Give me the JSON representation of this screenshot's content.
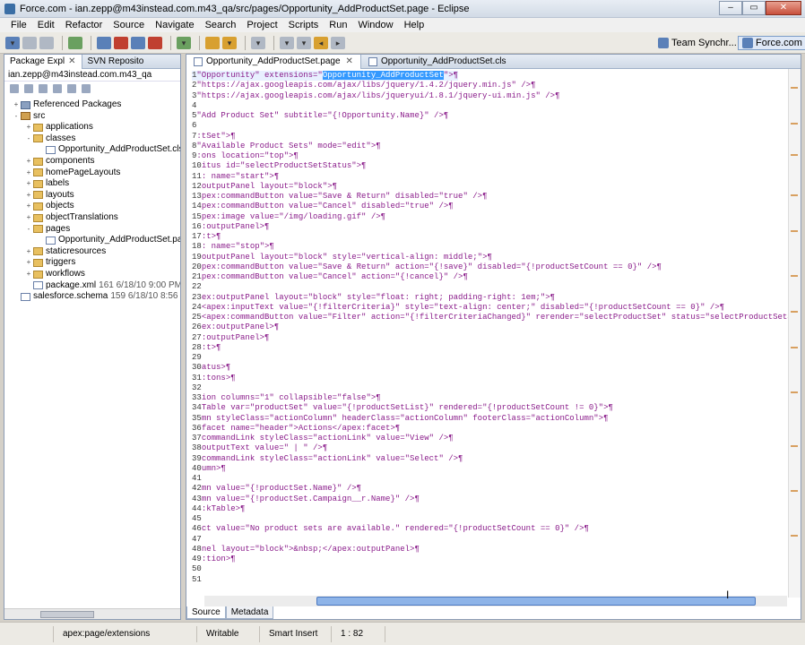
{
  "window": {
    "title": "Force.com - ian.zepp@m43instead.com.m43_qa/src/pages/Opportunity_AddProductSet.page - Eclipse"
  },
  "menu": [
    "File",
    "Edit",
    "Refactor",
    "Source",
    "Navigate",
    "Search",
    "Project",
    "Scripts",
    "Run",
    "Window",
    "Help"
  ],
  "perspectives": {
    "team": "Team Synchr...",
    "force": "Force.com"
  },
  "left": {
    "tabs": [
      {
        "label": "Package Expl"
      },
      {
        "label": "SVN Reposito"
      }
    ],
    "project": "ian.zepp@m43instead.com.m43_qa",
    "tree": [
      {
        "label": "Referenced Packages",
        "icon": "pkg",
        "indent": 0,
        "expander": "+"
      },
      {
        "label": "src",
        "icon": "src",
        "indent": 0,
        "expander": "-"
      },
      {
        "label": "applications",
        "icon": "folder",
        "indent": 1,
        "expander": "+"
      },
      {
        "label": "classes",
        "icon": "folder",
        "indent": 1,
        "expander": "-"
      },
      {
        "label": "Opportunity_AddProductSet.cls",
        "icon": "file",
        "indent": 2,
        "expander": ""
      },
      {
        "label": "components",
        "icon": "folder",
        "indent": 1,
        "expander": "+"
      },
      {
        "label": "homePageLayouts",
        "icon": "folder",
        "indent": 1,
        "expander": "+"
      },
      {
        "label": "labels",
        "icon": "folder",
        "indent": 1,
        "expander": "+"
      },
      {
        "label": "layouts",
        "icon": "folder",
        "indent": 1,
        "expander": "+"
      },
      {
        "label": "objects",
        "icon": "folder",
        "indent": 1,
        "expander": "+"
      },
      {
        "label": "objectTranslations",
        "icon": "folder",
        "indent": 1,
        "expander": "+"
      },
      {
        "label": "pages",
        "icon": "folder",
        "indent": 1,
        "expander": "-"
      },
      {
        "label": "Opportunity_AddProductSet.page",
        "icon": "file",
        "indent": 2,
        "expander": ""
      },
      {
        "label": "staticresources",
        "icon": "folder",
        "indent": 1,
        "expander": "+"
      },
      {
        "label": "triggers",
        "icon": "folder",
        "indent": 1,
        "expander": "+"
      },
      {
        "label": "workflows",
        "icon": "folder",
        "indent": 1,
        "expander": "+"
      },
      {
        "label": "package.xml",
        "icon": "file",
        "indent": 1,
        "expander": "",
        "meta": "161  6/18/10 9:00 PM  m43i"
      },
      {
        "label": "salesforce.schema",
        "icon": "file",
        "indent": 0,
        "expander": "",
        "meta": "159  6/18/10 8:56 PM  m43"
      }
    ]
  },
  "editor": {
    "tabs": [
      {
        "label": "Opportunity_AddProductSet.page"
      },
      {
        "label": "Opportunity_AddProductSet.cls"
      }
    ],
    "bottom_tabs": [
      "Source",
      "Metadata"
    ],
    "lines": [
      {
        "n": "1",
        "pre": "\"Opportunity\" extensions=\"",
        "sel": "Opportunity_AddProductSet",
        "post": "\">¶"
      },
      {
        "n": "2",
        "pre": "\"https://ajax.googleapis.com/ajax/libs/jquery/1.4.2/jquery.min.js\" />¶"
      },
      {
        "n": "3",
        "pre": "\"https://ajax.googleapis.com/ajax/libs/jqueryui/1.8.1/jquery-ui.min.js\" />¶"
      },
      {
        "n": "4",
        "pre": ""
      },
      {
        "n": "5",
        "pre": "\"Add Product Set\" subtitle=\"{!Opportunity.Name}\" />¶"
      },
      {
        "n": "6",
        "pre": ""
      },
      {
        "n": "7",
        "pre": ":tSet\">¶"
      },
      {
        "n": "8",
        "pre": "\"Available Product Sets\" mode=\"edit\">¶"
      },
      {
        "n": "9",
        "pre": ":ons location=\"top\">¶"
      },
      {
        "n": "10",
        "pre": "itus id=\"selectProductSetStatus\">¶"
      },
      {
        "n": "11",
        "pre": ": name=\"start\">¶"
      },
      {
        "n": "12",
        "pre": "outputPanel layout=\"block\">¶"
      },
      {
        "n": "13",
        "pre": "pex:commandButton value=\"Save & Return\" disabled=\"true\" />¶"
      },
      {
        "n": "14",
        "pre": "pex:commandButton value=\"Cancel\" disabled=\"true\" />¶"
      },
      {
        "n": "15",
        "pre": "pex:image value=\"/img/loading.gif\" />¶"
      },
      {
        "n": "16",
        "pre": ":outputPanel>¶"
      },
      {
        "n": "17",
        "pre": ":t>¶"
      },
      {
        "n": "18",
        "pre": ": name=\"stop\">¶"
      },
      {
        "n": "19",
        "pre": "outputPanel layout=\"block\" style=\"vertical-align: middle;\">¶"
      },
      {
        "n": "20",
        "pre": "pex:commandButton value=\"Save & Return\" action=\"{!save}\" disabled=\"{!productSetCount == 0}\" />¶"
      },
      {
        "n": "21",
        "pre": "pex:commandButton value=\"Cancel\" action=\"{!cancel}\" />¶"
      },
      {
        "n": "22",
        "pre": ""
      },
      {
        "n": "23",
        "pre": "ex:outputPanel layout=\"block\" style=\"float: right; padding-right: 1em;\">¶"
      },
      {
        "n": "24",
        "pre": "<apex:inputText value=\"{!filterCriteria}\" style=\"text-align: center;\" disabled=\"{!productSetCount == 0}\" />¶"
      },
      {
        "n": "25",
        "pre": "<apex:commandButton value=\"Filter\" action=\"{!filterCriteriaChanged}\" rerender=\"selectProductSet\" status=\"selectProductSetStatus\""
      },
      {
        "n": "26",
        "pre": "ex:outputPanel>¶"
      },
      {
        "n": "27",
        "pre": ":outputPanel>¶"
      },
      {
        "n": "28",
        "pre": ":t>¶"
      },
      {
        "n": "29",
        "pre": ""
      },
      {
        "n": "30",
        "pre": "atus>¶"
      },
      {
        "n": "31",
        "pre": ":tons>¶"
      },
      {
        "n": "32",
        "pre": ""
      },
      {
        "n": "33",
        "pre": "ion columns=\"1\" collapsible=\"false\">¶"
      },
      {
        "n": "34",
        "pre": "Table var=\"productSet\" value=\"{!productSetList}\" rendered=\"{!productSetCount != 0}\">¶"
      },
      {
        "n": "35",
        "pre": "mn styleClass=\"actionColumn\" headerClass=\"actionColumn\" footerClass=\"actionColumn\">¶"
      },
      {
        "n": "36",
        "pre": "facet name=\"header\">Actions</apex:facet>¶"
      },
      {
        "n": "37",
        "pre": "commandLink styleClass=\"actionLink\" value=\"View\" />¶"
      },
      {
        "n": "38",
        "pre": "outputText value=\" | \" />¶"
      },
      {
        "n": "39",
        "pre": "commandLink styleClass=\"actionLink\" value=\"Select\" />¶"
      },
      {
        "n": "40",
        "pre": "umn>¶"
      },
      {
        "n": "41",
        "pre": ""
      },
      {
        "n": "42",
        "pre": "mn value=\"{!productSet.Name}\" />¶"
      },
      {
        "n": "43",
        "pre": "mn value=\"{!productSet.Campaign__r.Name}\" />¶"
      },
      {
        "n": "44",
        "pre": ":kTable>¶"
      },
      {
        "n": "45",
        "pre": ""
      },
      {
        "n": "46",
        "pre": "ct value=\"No product sets are available.\" rendered=\"{!productSetCount == 0}\" />¶"
      },
      {
        "n": "47",
        "pre": ""
      },
      {
        "n": "48",
        "pre": "nel layout=\"block\">&nbsp;</apex:outputPanel>¶"
      },
      {
        "n": "49",
        "pre": ":tion>¶"
      },
      {
        "n": "50",
        "pre": ""
      },
      {
        "n": "51",
        "pre": ""
      }
    ]
  },
  "status": {
    "element": "apex:page/extensions",
    "mode": "Writable",
    "insert": "Smart Insert",
    "position": "1 : 82"
  }
}
